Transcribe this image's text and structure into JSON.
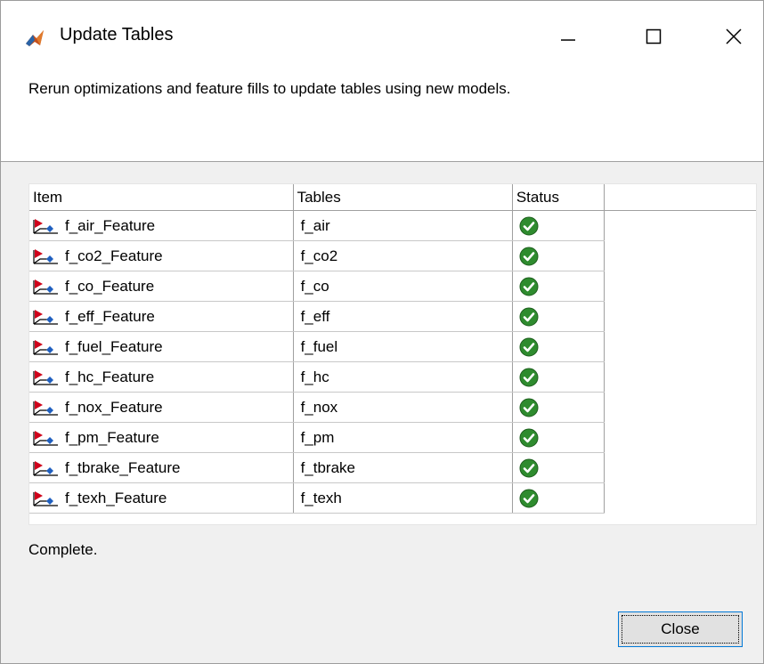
{
  "window": {
    "title": "Update Tables",
    "app_icon": "matlab-logo-icon",
    "controls": [
      "minimize-icon",
      "maximize-icon",
      "close-icon"
    ]
  },
  "description": "Rerun optimizations and feature fills to update tables using new models.",
  "table": {
    "columns": [
      "Item",
      "Tables",
      "Status"
    ],
    "rows": [
      {
        "item": "f_air_Feature",
        "table": "f_air",
        "status": "ok"
      },
      {
        "item": "f_co2_Feature",
        "table": "f_co2",
        "status": "ok"
      },
      {
        "item": "f_co_Feature",
        "table": "f_co",
        "status": "ok"
      },
      {
        "item": "f_eff_Feature",
        "table": "f_eff",
        "status": "ok"
      },
      {
        "item": "f_fuel_Feature",
        "table": "f_fuel",
        "status": "ok"
      },
      {
        "item": "f_hc_Feature",
        "table": "f_hc",
        "status": "ok"
      },
      {
        "item": "f_nox_Feature",
        "table": "f_nox",
        "status": "ok"
      },
      {
        "item": "f_pm_Feature",
        "table": "f_pm",
        "status": "ok"
      },
      {
        "item": "f_tbrake_Feature",
        "table": "f_tbrake",
        "status": "ok"
      },
      {
        "item": "f_texh_Feature",
        "table": "f_texh",
        "status": "ok"
      }
    ],
    "status_icon": "check-circle-icon",
    "item_icon": "feature-icon"
  },
  "status_text": "Complete.",
  "buttons": {
    "close_label": "Close"
  },
  "colors": {
    "check_green": "#2e8b2e",
    "focus_border": "#0078d7"
  }
}
